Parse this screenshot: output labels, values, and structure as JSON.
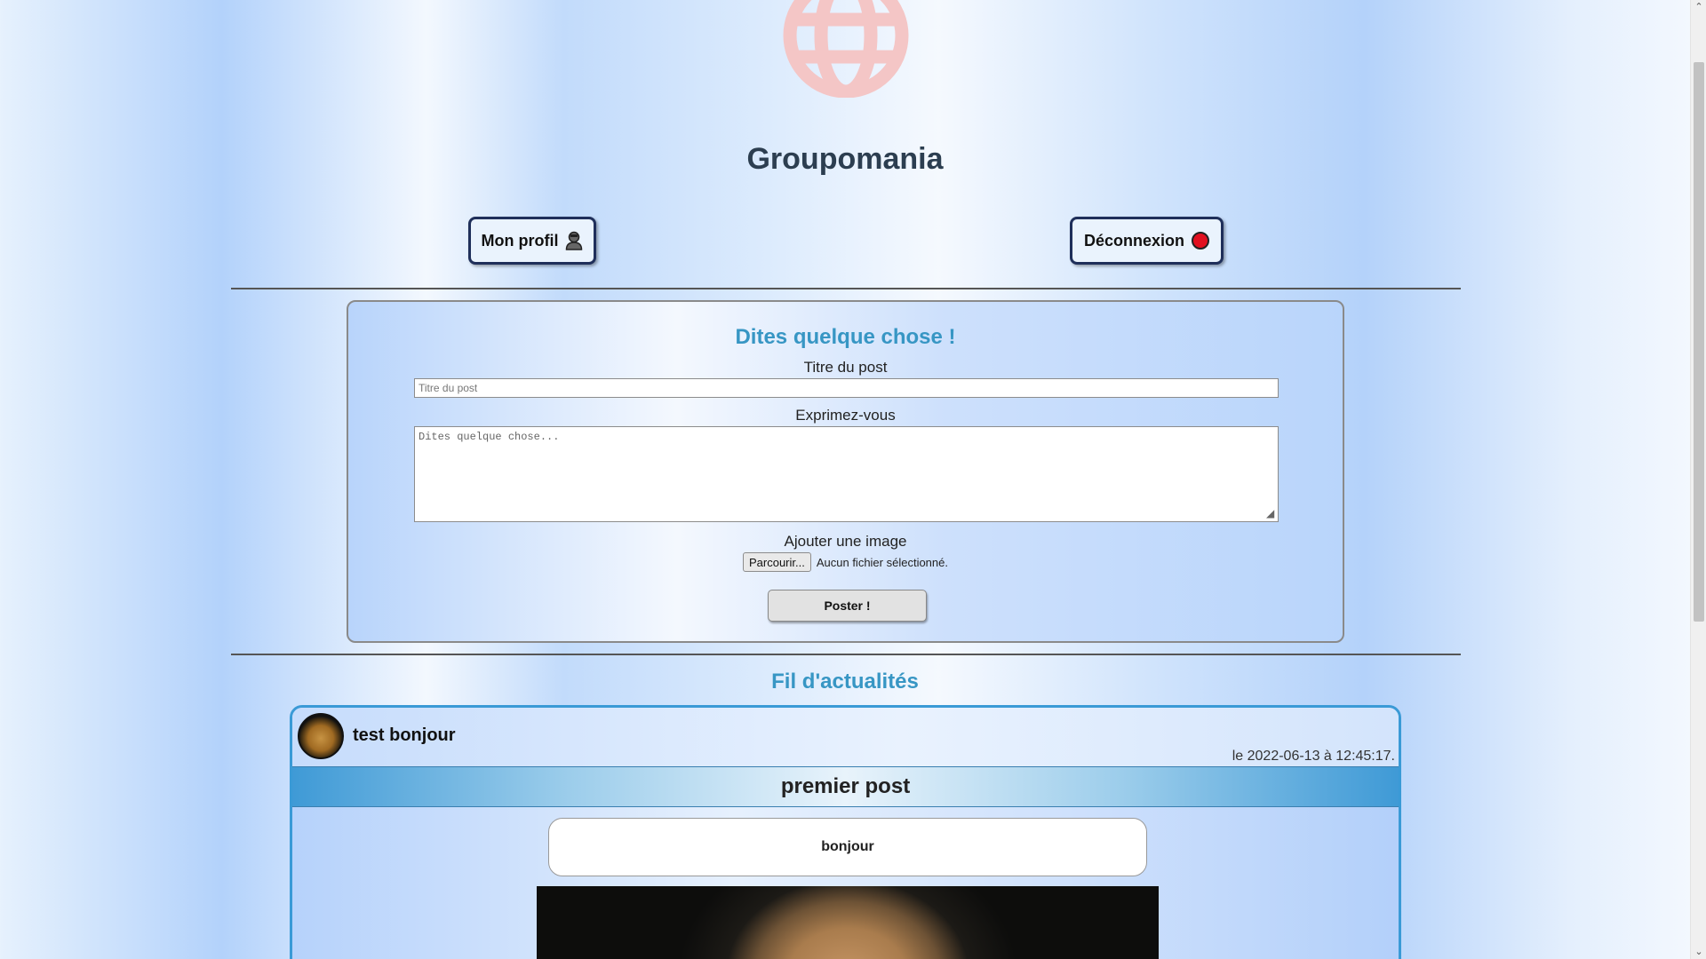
{
  "site": {
    "title": "Groupomania",
    "logo_icon": "globe-icon"
  },
  "nav": {
    "profile_label": "Mon profil",
    "profile_icon": "user-icon",
    "logout_label": "Déconnexion",
    "logout_icon": "red-dot-icon"
  },
  "form": {
    "heading": "Dites quelque chose !",
    "title_label": "Titre du post",
    "title_placeholder": "Titre du post",
    "body_label": "Exprimez-vous",
    "body_placeholder": "Dites quelque chose...",
    "image_label": "Ajouter une image",
    "browse_button": "Parcourir...",
    "file_status": "Aucun fichier sélectionné.",
    "submit_label": "Poster !"
  },
  "feed": {
    "heading": "Fil d'actualités",
    "posts": [
      {
        "author": "test bonjour",
        "date": "le 2022-06-13 à 12:45:17.",
        "title": "premier post",
        "body": "bonjour"
      }
    ]
  },
  "colors": {
    "accent": "#3796c4",
    "title": "#2c3e50",
    "logo": "#f4c6c6",
    "logout_dot": "#e2101f",
    "post_border": "#3a9ad6"
  }
}
